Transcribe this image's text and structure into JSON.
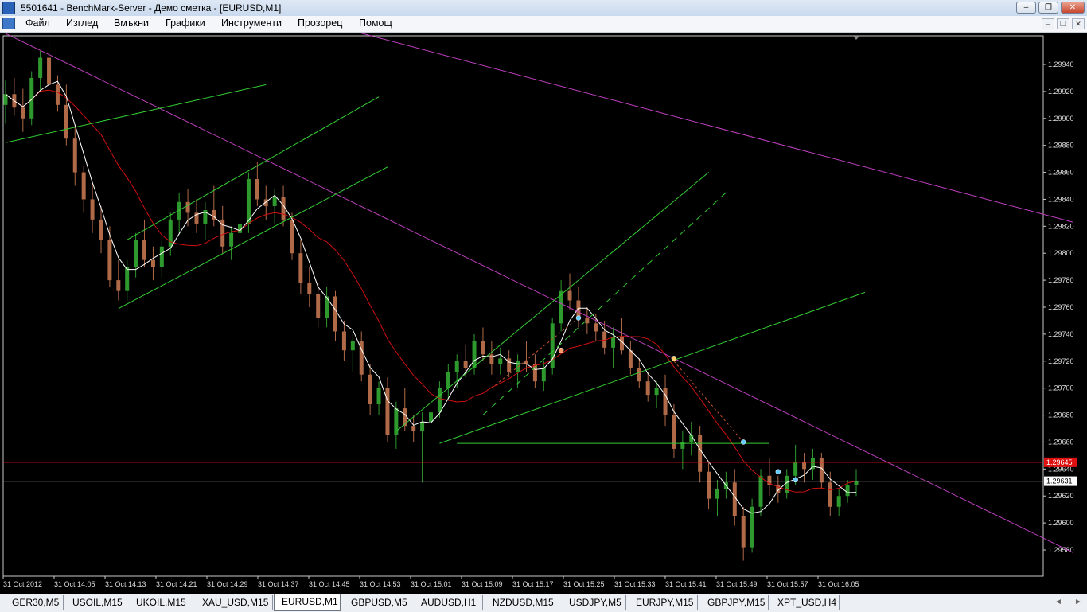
{
  "window": {
    "title": "5501641 - BenchMark-Server - Демо сметка - [EURUSD,M1]",
    "controls": [
      "‒",
      "❐",
      "✕"
    ]
  },
  "menu": {
    "items": [
      "Файл",
      "Изглед",
      "Вмъкни",
      "Графики",
      "Инструменти",
      "Прозорец",
      "Помощ"
    ]
  },
  "chart_data": {
    "type": "candlestick",
    "symbol": "EURUSD",
    "timeframe": "M1",
    "ylim": [
      1.2957,
      1.2998
    ],
    "price_levels": [
      "1.29940",
      "1.29920",
      "1.29900",
      "1.29880",
      "1.29860",
      "1.29840",
      "1.29820",
      "1.29800",
      "1.29780",
      "1.29760",
      "1.29740",
      "1.29720",
      "1.29700",
      "1.29680",
      "1.29660",
      "1.29640",
      "1.29620",
      "1.29600",
      "1.29580"
    ],
    "time_labels": [
      "31 Oct 2012",
      "31 Oct 14:05",
      "31 Oct 14:13",
      "31 Oct 14:21",
      "31 Oct 14:29",
      "31 Oct 14:37",
      "31 Oct 14:45",
      "31 Oct 14:53",
      "31 Oct 15:01",
      "31 Oct 15:09",
      "31 Oct 15:17",
      "31 Oct 15:25",
      "31 Oct 15:33",
      "31 Oct 15:41",
      "31 Oct 15:49",
      "31 Oct 15:57",
      "31 Oct 16:05"
    ],
    "ask_label": "1.29645",
    "bid_label": "1.29631",
    "ask_price": 1.29645,
    "bid_price": 1.29631,
    "colors": {
      "bull": "#2e9a2e",
      "bear": "#b06a48",
      "fast_ma": "#ffffff",
      "slow_ma": "#d01010",
      "trendline": "#c040c0",
      "channel": "#33cc33",
      "ask_line": "#e01010",
      "bid_line": "#ffffff"
    },
    "candles": [
      [
        1.2991,
        1.29928,
        1.29896,
        1.29918
      ],
      [
        1.29918,
        1.2993,
        1.29902,
        1.29908
      ],
      [
        1.29908,
        1.29922,
        1.2989,
        1.299
      ],
      [
        1.299,
        1.29935,
        1.29895,
        1.2993
      ],
      [
        1.2993,
        1.2995,
        1.2992,
        1.29945
      ],
      [
        1.29945,
        1.2996,
        1.29935,
        1.29925
      ],
      [
        1.29925,
        1.29932,
        1.29905,
        1.2991
      ],
      [
        1.2991,
        1.29925,
        1.2988,
        1.29885
      ],
      [
        1.29885,
        1.29895,
        1.2985,
        1.2986
      ],
      [
        1.2986,
        1.29865,
        1.2983,
        1.2984
      ],
      [
        1.2984,
        1.29852,
        1.29815,
        1.29825
      ],
      [
        1.29825,
        1.29835,
        1.298,
        1.2981
      ],
      [
        1.2981,
        1.2982,
        1.29775,
        1.2978
      ],
      [
        1.2978,
        1.29795,
        1.29765,
        1.29772
      ],
      [
        1.29772,
        1.29795,
        1.29765,
        1.2979
      ],
      [
        1.2979,
        1.29815,
        1.29782,
        1.2981
      ],
      [
        1.2981,
        1.29825,
        1.2979,
        1.29795
      ],
      [
        1.29795,
        1.29805,
        1.2978,
        1.2979
      ],
      [
        1.2979,
        1.2981,
        1.29782,
        1.29805
      ],
      [
        1.29805,
        1.2983,
        1.29798,
        1.29825
      ],
      [
        1.29825,
        1.29845,
        1.29815,
        1.29838
      ],
      [
        1.29838,
        1.29848,
        1.2982,
        1.2983
      ],
      [
        1.2983,
        1.2984,
        1.29815,
        1.29822
      ],
      [
        1.29822,
        1.29838,
        1.2981,
        1.29832
      ],
      [
        1.29832,
        1.2985,
        1.2982,
        1.29825
      ],
      [
        1.29825,
        1.29835,
        1.298,
        1.29805
      ],
      [
        1.29805,
        1.2982,
        1.29795,
        1.29815
      ],
      [
        1.29815,
        1.2983,
        1.298,
        1.29822
      ],
      [
        1.29822,
        1.2986,
        1.29815,
        1.29855
      ],
      [
        1.29855,
        1.29868,
        1.29835,
        1.2984
      ],
      [
        1.2984,
        1.2985,
        1.29825,
        1.29835
      ],
      [
        1.29835,
        1.29848,
        1.29822,
        1.29842
      ],
      [
        1.29842,
        1.2985,
        1.2982,
        1.29825
      ],
      [
        1.29825,
        1.2983,
        1.29795,
        1.298
      ],
      [
        1.298,
        1.2981,
        1.2977,
        1.29778
      ],
      [
        1.29778,
        1.2979,
        1.2976,
        1.2977
      ],
      [
        1.2977,
        1.29778,
        1.29745,
        1.29752
      ],
      [
        1.29752,
        1.29775,
        1.29745,
        1.29768
      ],
      [
        1.29768,
        1.29772,
        1.29735,
        1.29742
      ],
      [
        1.29742,
        1.2975,
        1.2972,
        1.29728
      ],
      [
        1.29728,
        1.2974,
        1.29712,
        1.29735
      ],
      [
        1.29735,
        1.29742,
        1.29705,
        1.2971
      ],
      [
        1.2971,
        1.29718,
        1.2968,
        1.29688
      ],
      [
        1.29688,
        1.29705,
        1.2968,
        1.297
      ],
      [
        1.297,
        1.29708,
        1.2966,
        1.29665
      ],
      [
        1.29665,
        1.2969,
        1.29655,
        1.29685
      ],
      [
        1.29685,
        1.297,
        1.29668,
        1.29672
      ],
      [
        1.29672,
        1.2968,
        1.2966,
        1.29668
      ],
      [
        1.29668,
        1.29682,
        1.2963,
        1.29675
      ],
      [
        1.29675,
        1.29688,
        1.29668,
        1.29682
      ],
      [
        1.29682,
        1.29705,
        1.29678,
        1.297
      ],
      [
        1.297,
        1.29718,
        1.29692,
        1.29712
      ],
      [
        1.29712,
        1.29725,
        1.297,
        1.2972
      ],
      [
        1.2972,
        1.29732,
        1.29708,
        1.29715
      ],
      [
        1.29715,
        1.2974,
        1.2971,
        1.29735
      ],
      [
        1.29735,
        1.29745,
        1.2972,
        1.29725
      ],
      [
        1.29725,
        1.29735,
        1.2971,
        1.29718
      ],
      [
        1.29718,
        1.2973,
        1.2971,
        1.29722
      ],
      [
        1.29722,
        1.29728,
        1.29708,
        1.29712
      ],
      [
        1.29712,
        1.29725,
        1.297,
        1.2972
      ],
      [
        1.2972,
        1.29735,
        1.29712,
        1.29718
      ],
      [
        1.29718,
        1.29725,
        1.297,
        1.29705
      ],
      [
        1.29705,
        1.2972,
        1.29698,
        1.29715
      ],
      [
        1.29715,
        1.29752,
        1.2971,
        1.29748
      ],
      [
        1.29748,
        1.2978,
        1.29742,
        1.29772
      ],
      [
        1.29772,
        1.29785,
        1.29758,
        1.29765
      ],
      [
        1.29765,
        1.29775,
        1.29745,
        1.29752
      ],
      [
        1.29752,
        1.2976,
        1.2974,
        1.29748
      ],
      [
        1.29748,
        1.29755,
        1.29735,
        1.29742
      ],
      [
        1.29742,
        1.2975,
        1.29725,
        1.2973
      ],
      [
        1.2973,
        1.29745,
        1.29715,
        1.29738
      ],
      [
        1.29738,
        1.29752,
        1.29725,
        1.29728
      ],
      [
        1.29728,
        1.29735,
        1.2971,
        1.29715
      ],
      [
        1.29715,
        1.29722,
        1.297,
        1.29705
      ],
      [
        1.29705,
        1.29712,
        1.2969,
        1.29695
      ],
      [
        1.29695,
        1.29705,
        1.29685,
        1.297
      ],
      [
        1.297,
        1.2971,
        1.29672,
        1.2968
      ],
      [
        1.2968,
        1.29688,
        1.29648,
        1.29655
      ],
      [
        1.29655,
        1.29668,
        1.2964,
        1.2966
      ],
      [
        1.2966,
        1.29675,
        1.2965,
        1.29665
      ],
      [
        1.29665,
        1.29672,
        1.2963,
        1.29638
      ],
      [
        1.29638,
        1.29645,
        1.2961,
        1.29618
      ],
      [
        1.29618,
        1.29632,
        1.29605,
        1.29625
      ],
      [
        1.29625,
        1.29638,
        1.29618,
        1.2963
      ],
      [
        1.2963,
        1.2964,
        1.29598,
        1.29605
      ],
      [
        1.29605,
        1.29612,
        1.29572,
        1.29582
      ],
      [
        1.29582,
        1.29618,
        1.29578,
        1.29612
      ],
      [
        1.29612,
        1.2964,
        1.29605,
        1.29635
      ],
      [
        1.29635,
        1.29648,
        1.2962,
        1.29628
      ],
      [
        1.29628,
        1.29635,
        1.29615,
        1.29622
      ],
      [
        1.29622,
        1.2964,
        1.29618,
        1.29635
      ],
      [
        1.29635,
        1.29658,
        1.29628,
        1.29645
      ],
      [
        1.29645,
        1.29652,
        1.2963,
        1.2964
      ],
      [
        1.2964,
        1.29655,
        1.29632,
        1.29648
      ],
      [
        1.29648,
        1.29652,
        1.29625,
        1.2963
      ],
      [
        1.2963,
        1.29638,
        1.29605,
        1.29612
      ],
      [
        1.29612,
        1.29625,
        1.29605,
        1.2962
      ],
      [
        1.2962,
        1.29632,
        1.29615,
        1.29628
      ],
      [
        1.29628,
        1.2964,
        1.2962,
        1.29631
      ]
    ]
  },
  "tabs": [
    {
      "label": "GER30,M5",
      "active": false
    },
    {
      "label": "USOIL,M15",
      "active": false
    },
    {
      "label": "UKOIL,M15",
      "active": false
    },
    {
      "label": "XAU_USD,M15",
      "active": false
    },
    {
      "label": "EURUSD,M1",
      "active": true
    },
    {
      "label": "GBPUSD,M5",
      "active": false
    },
    {
      "label": "AUDUSD,H1",
      "active": false
    },
    {
      "label": "NZDUSD,M15",
      "active": false
    },
    {
      "label": "USDJPY,M5",
      "active": false
    },
    {
      "label": "EURJPY,M15",
      "active": false
    },
    {
      "label": "GBPJPY,M15",
      "active": false
    },
    {
      "label": "XPT_USD,H4",
      "active": false
    }
  ],
  "tab_scroll": {
    "left": "◄",
    "right": "►"
  },
  "mdi_controls": [
    "‒",
    "❐",
    "✕"
  ]
}
